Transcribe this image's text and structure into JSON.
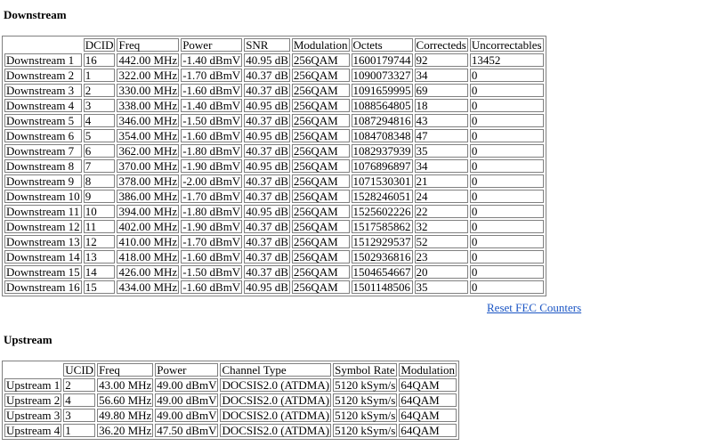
{
  "downstream": {
    "title": "Downstream",
    "headers": [
      "",
      "DCID",
      "Freq",
      "Power",
      "SNR",
      "Modulation",
      "Octets",
      "Correcteds",
      "Uncorrectables"
    ],
    "rows": [
      [
        "Downstream 1",
        "16",
        "442.00 MHz",
        "-1.40 dBmV",
        "40.95 dB",
        "256QAM",
        "1600179744",
        "92",
        "13452"
      ],
      [
        "Downstream 2",
        "1",
        "322.00 MHz",
        "-1.70 dBmV",
        "40.37 dB",
        "256QAM",
        "1090073327",
        "34",
        "0"
      ],
      [
        "Downstream 3",
        "2",
        "330.00 MHz",
        "-1.60 dBmV",
        "40.37 dB",
        "256QAM",
        "1091659995",
        "69",
        "0"
      ],
      [
        "Downstream 4",
        "3",
        "338.00 MHz",
        "-1.40 dBmV",
        "40.95 dB",
        "256QAM",
        "1088564805",
        "18",
        "0"
      ],
      [
        "Downstream 5",
        "4",
        "346.00 MHz",
        "-1.50 dBmV",
        "40.37 dB",
        "256QAM",
        "1087294816",
        "43",
        "0"
      ],
      [
        "Downstream 6",
        "5",
        "354.00 MHz",
        "-1.60 dBmV",
        "40.95 dB",
        "256QAM",
        "1084708348",
        "47",
        "0"
      ],
      [
        "Downstream 7",
        "6",
        "362.00 MHz",
        "-1.80 dBmV",
        "40.37 dB",
        "256QAM",
        "1082937939",
        "35",
        "0"
      ],
      [
        "Downstream 8",
        "7",
        "370.00 MHz",
        "-1.90 dBmV",
        "40.95 dB",
        "256QAM",
        "1076896897",
        "34",
        "0"
      ],
      [
        "Downstream 9",
        "8",
        "378.00 MHz",
        "-2.00 dBmV",
        "40.37 dB",
        "256QAM",
        "1071530301",
        "21",
        "0"
      ],
      [
        "Downstream 10",
        "9",
        "386.00 MHz",
        "-1.70 dBmV",
        "40.37 dB",
        "256QAM",
        "1528246051",
        "24",
        "0"
      ],
      [
        "Downstream 11",
        "10",
        "394.00 MHz",
        "-1.80 dBmV",
        "40.95 dB",
        "256QAM",
        "1525602226",
        "22",
        "0"
      ],
      [
        "Downstream 12",
        "11",
        "402.00 MHz",
        "-1.90 dBmV",
        "40.37 dB",
        "256QAM",
        "1517585862",
        "32",
        "0"
      ],
      [
        "Downstream 13",
        "12",
        "410.00 MHz",
        "-1.70 dBmV",
        "40.37 dB",
        "256QAM",
        "1512929537",
        "52",
        "0"
      ],
      [
        "Downstream 14",
        "13",
        "418.00 MHz",
        "-1.60 dBmV",
        "40.37 dB",
        "256QAM",
        "1502936816",
        "23",
        "0"
      ],
      [
        "Downstream 15",
        "14",
        "426.00 MHz",
        "-1.50 dBmV",
        "40.37 dB",
        "256QAM",
        "1504654667",
        "20",
        "0"
      ],
      [
        "Downstream 16",
        "15",
        "434.00 MHz",
        "-1.60 dBmV",
        "40.95 dB",
        "256QAM",
        "1501148506",
        "35",
        "0"
      ]
    ],
    "reset_link": "Reset FEC Counters"
  },
  "upstream": {
    "title": "Upstream",
    "headers": [
      "",
      "UCID",
      "Freq",
      "Power",
      "Channel Type",
      "Symbol Rate",
      "Modulation"
    ],
    "rows": [
      [
        "Upstream 1",
        "2",
        "43.00 MHz",
        "49.00 dBmV",
        "DOCSIS2.0 (ATDMA)",
        "5120 kSym/s",
        "64QAM"
      ],
      [
        "Upstream 2",
        "4",
        "56.60 MHz",
        "49.00 dBmV",
        "DOCSIS2.0 (ATDMA)",
        "5120 kSym/s",
        "64QAM"
      ],
      [
        "Upstream 3",
        "3",
        "49.80 MHz",
        "49.00 dBmV",
        "DOCSIS2.0 (ATDMA)",
        "5120 kSym/s",
        "64QAM"
      ],
      [
        "Upstream 4",
        "1",
        "36.20 MHz",
        "47.50 dBmV",
        "DOCSIS2.0 (ATDMA)",
        "5120 kSym/s",
        "64QAM"
      ]
    ]
  }
}
